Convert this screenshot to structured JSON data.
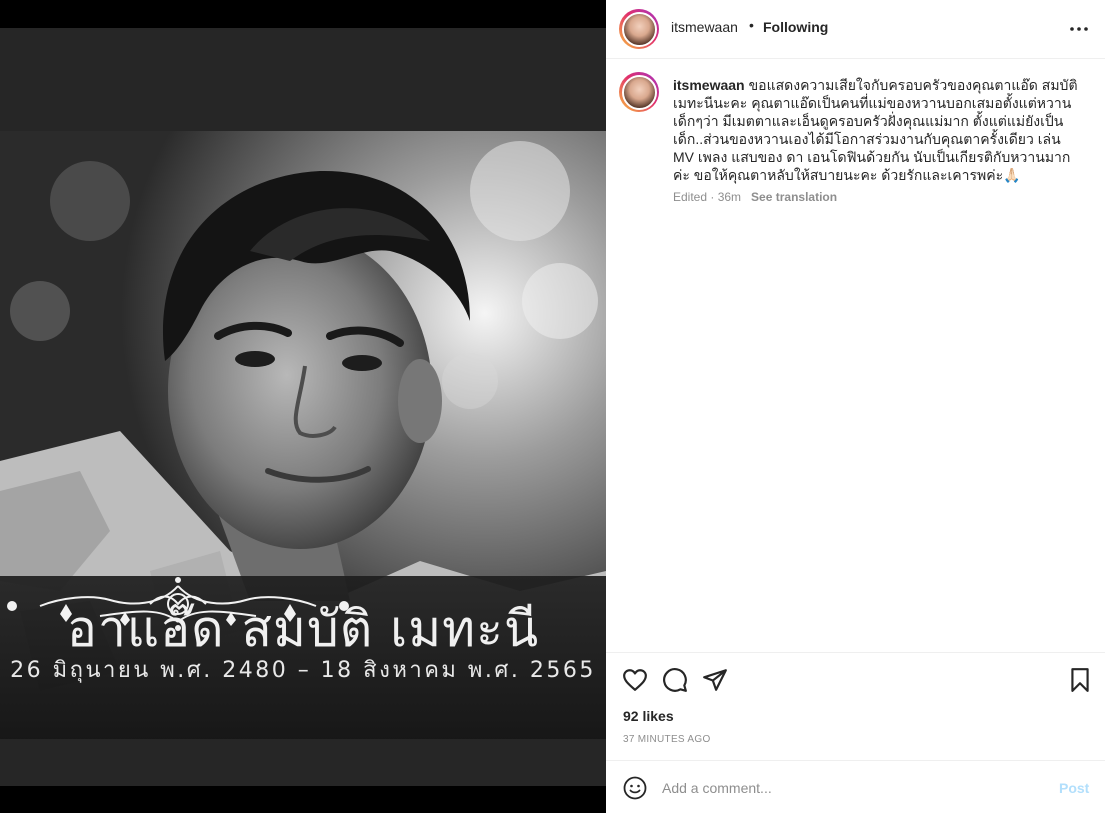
{
  "media": {
    "caption_name": "อาแอ๊ด สมบัติ เมทะนี",
    "caption_dates": "26 มิถุนายน พ.ศ. 2480 – 18 สิงหาคม พ.ศ. 2565"
  },
  "header": {
    "username": "itsmewaan",
    "separator": "•",
    "follow_status": "Following",
    "more_icon": "more-horizontal-icon"
  },
  "post": {
    "username": "itsmewaan",
    "caption": "ขอแสดงความเสียใจกับครอบครัวของคุณตาแอ๊ด สมบัติ เมทะนีนะคะ คุณตาแอ๊ดเป็นคนที่แม่ของหวานบอกเสมอตั้งแต่หวานเด็กๆว่า มีเมตตาและเอ็นดูครอบครัวฝั่งคุณแม่มาก ตั้งแต่แม่ยังเป็นเด็ก..ส่วนของหวานเองได้มีโอกาสร่วมงานกับคุณตาครั้งเดียว เล่น MV เพลง แสบของ ดา เอนโดฟินด้วยกัน นับเป็นเกียรติกับหวานมากค่ะ ขอให้คุณตาหลับให้สบายนะคะ ด้วยรักและเคารพค่ะ🙏🏻",
    "edited_label": "Edited · 36m",
    "see_translation": "See translation"
  },
  "actions": {
    "icons": [
      "heart-icon",
      "comment-icon",
      "share-icon",
      "bookmark-icon"
    ],
    "likes": "92 likes",
    "time_ago": "37 MINUTES AGO"
  },
  "comment_bar": {
    "emoji_icon": "emoji-icon",
    "placeholder": "Add a comment...",
    "post_label": "Post",
    "post_color": "#b2dffc"
  },
  "colors": {
    "text": "#262626",
    "secondary": "#8e8e8e",
    "divider": "#efefef"
  }
}
